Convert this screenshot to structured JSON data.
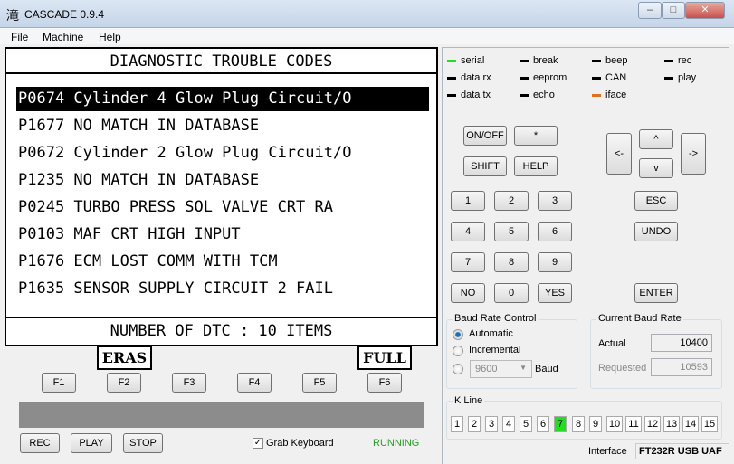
{
  "title": {
    "icon": "滝",
    "text": "CASCADE 0.9.4",
    "minimize": "–",
    "maximize": "□",
    "close": "✕"
  },
  "menu": [
    "File",
    "Machine",
    "Help"
  ],
  "display": {
    "header": "DIAGNOSTIC TROUBLE CODES",
    "codes": [
      "P0674 Cylinder 4 Glow Plug Circuit/O",
      "P1677 NO MATCH IN DATABASE",
      "P0672 Cylinder 2 Glow Plug Circuit/O",
      "P1235 NO MATCH IN DATABASE",
      "P0245 TURBO PRESS SOL VALVE CRT RA",
      "P0103 MAF CRT HIGH INPUT",
      "P1676 ECM LOST COMM WITH TCM",
      "P1635 SENSOR SUPPLY CIRCUIT 2 FAIL"
    ],
    "footer": "NUMBER OF DTC  : 10 ITEMS",
    "left_label": "ERAS",
    "right_label": "FULL"
  },
  "fkeys": [
    "F1",
    "F2",
    "F3",
    "F4",
    "F5",
    "F6"
  ],
  "controls": {
    "rec": "REC",
    "play": "PLAY",
    "stop": "STOP",
    "grab": "Grab Keyboard",
    "grab_checked": true,
    "status": "RUNNING"
  },
  "indicators": [
    {
      "label": "serial",
      "color": "#22dd22"
    },
    {
      "label": "break",
      "color": "#000000"
    },
    {
      "label": "beep",
      "color": "#000000"
    },
    {
      "label": "rec",
      "color": "#000000"
    },
    {
      "label": "data rx",
      "color": "#000000"
    },
    {
      "label": "eeprom",
      "color": "#000000"
    },
    {
      "label": "CAN",
      "color": "#000000"
    },
    {
      "label": "play",
      "color": "#000000"
    },
    {
      "label": "data tx",
      "color": "#000000"
    },
    {
      "label": "echo",
      "color": "#000000"
    },
    {
      "label": "iface",
      "color": "#e07020"
    }
  ],
  "keys": {
    "onoff": "ON/OFF",
    "star": "*",
    "shift": "SHIFT",
    "help": "HELP",
    "left": "<-",
    "up": "^",
    "down": "v",
    "right": "->",
    "nums": [
      "1",
      "2",
      "3",
      "4",
      "5",
      "6",
      "7",
      "8",
      "9"
    ],
    "no": "NO",
    "zero": "0",
    "yes": "YES",
    "esc": "ESC",
    "undo": "UNDO",
    "enter": "ENTER"
  },
  "baud": {
    "title": "Baud Rate Control",
    "automatic": "Automatic",
    "incremental": "Incremental",
    "select": "9600",
    "unit": "Baud",
    "selected": "Automatic"
  },
  "current": {
    "title": "Current Baud Rate",
    "actual_label": "Actual",
    "actual": "10400",
    "requested_label": "Requested",
    "requested": "10593"
  },
  "kline": {
    "title": "K Line",
    "lines": [
      "1",
      "2",
      "3",
      "4",
      "5",
      "6",
      "7",
      "8",
      "9",
      "10",
      "11",
      "12",
      "13",
      "14",
      "15"
    ],
    "active": "7"
  },
  "interface": {
    "label": "Interface",
    "value": "FT232R USB UAF"
  }
}
